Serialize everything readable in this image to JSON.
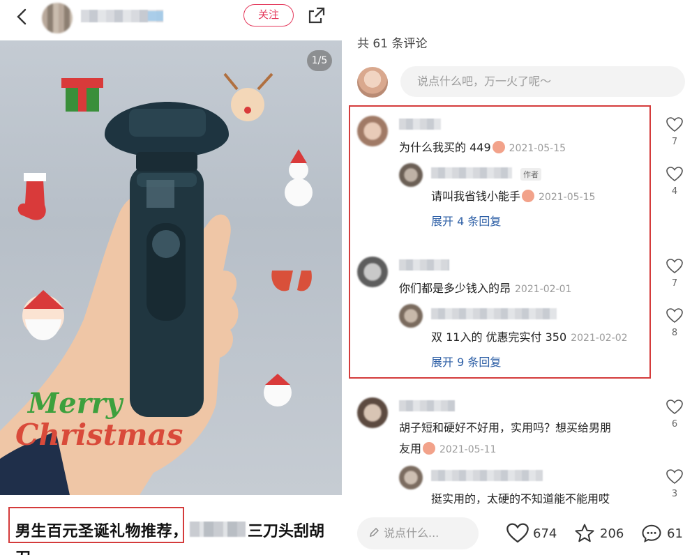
{
  "header": {
    "follow_label": "关注"
  },
  "post": {
    "page_indicator": "1/5",
    "caption_main": "男生百元圣诞礼物推荐，",
    "caption_tail": "三刀头刮胡",
    "caption_line2": "刀",
    "overlay_text": "Merry Christmas"
  },
  "comments_panel": {
    "count_label": "共 61 条评论",
    "input_placeholder": "说点什么吧，万一火了呢～",
    "items": [
      {
        "text": "为什么我买的 449",
        "date": "2021-05-15",
        "likes": "7"
      },
      {
        "text": "请叫我省钱小能手",
        "date": "2021-05-15",
        "likes": "4",
        "tag": "作者"
      },
      {
        "expand": "展开 4 条回复"
      },
      {
        "text": "你们都是多少钱入的昂",
        "date": "2021-02-01",
        "likes": "7"
      },
      {
        "text": "双 11入的  优惠完实付 350",
        "date": "2021-02-02",
        "likes": "8"
      },
      {
        "expand": "展开 9 条回复"
      },
      {
        "text": "胡子短和硬好不好用，实用吗？想买给男朋",
        "likes": "6"
      },
      {
        "text": "友用",
        "date": "2021-05-11"
      },
      {
        "text": "挺实用的，太硬的不知道能不能用哎",
        "likes": "3"
      }
    ]
  },
  "bottom_bar": {
    "input_placeholder": "说点什么...",
    "likes": "674",
    "stars": "206",
    "comments": "61"
  },
  "colors": {
    "accent": "#e4375a",
    "highlight": "#d43b3b",
    "link": "#2d5fa6"
  }
}
